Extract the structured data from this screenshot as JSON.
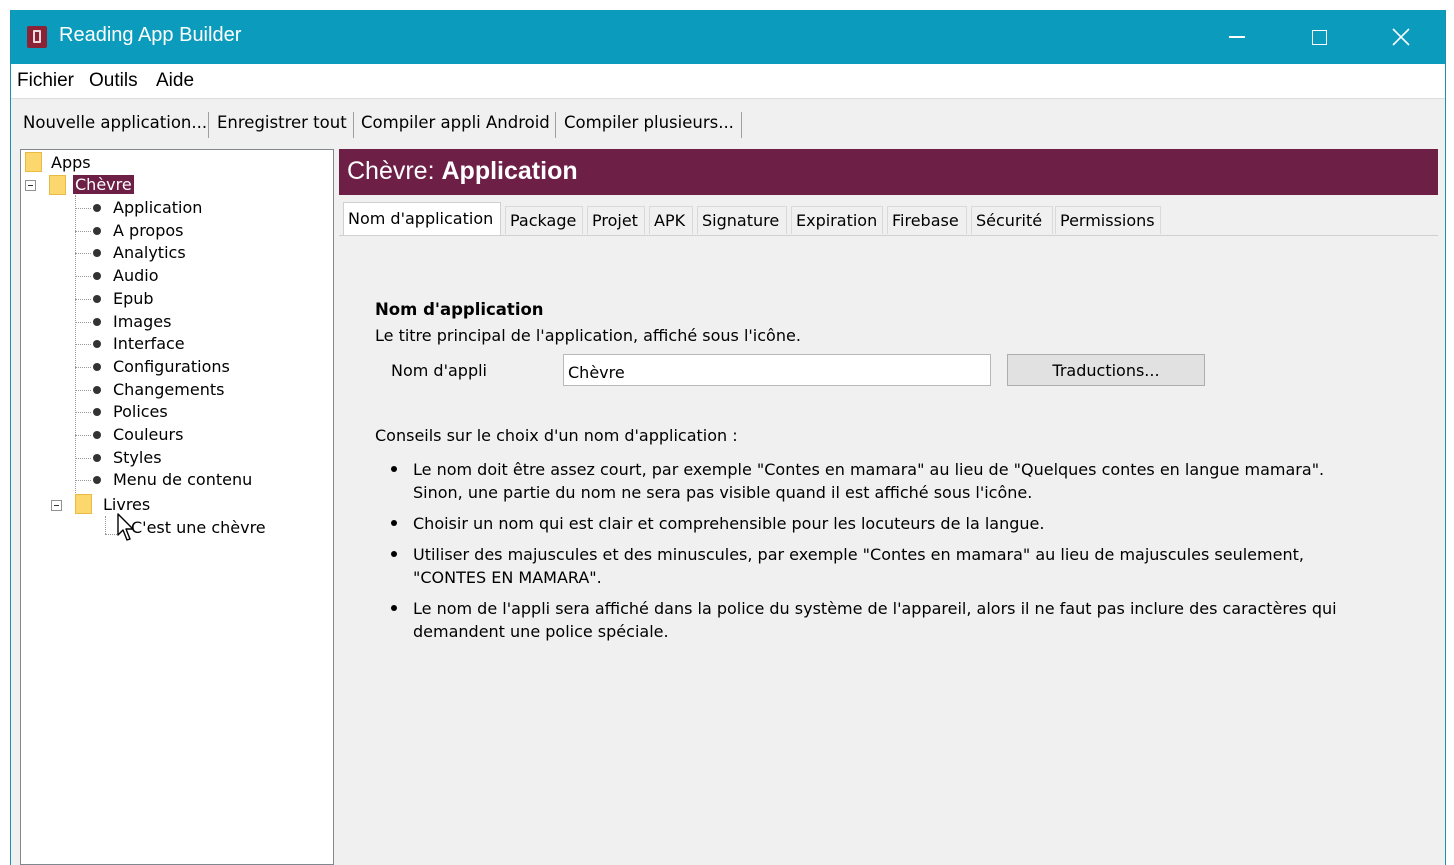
{
  "window": {
    "title": "Reading App Builder"
  },
  "menubar": [
    "Fichier",
    "Outils",
    "Aide"
  ],
  "toolbar": [
    "Nouvelle application...",
    "Enregistrer tout",
    "Compiler appli Android",
    "Compiler plusieurs..."
  ],
  "tree": {
    "root": "Apps",
    "app": "Chèvre",
    "app_items": [
      "Application",
      "A propos",
      "Analytics",
      "Audio",
      "Epub",
      "Images",
      "Interface",
      "Configurations",
      "Changements",
      "Polices",
      "Couleurs",
      "Styles",
      "Menu de contenu"
    ],
    "books_folder": "Livres",
    "books": [
      "C'est une chèvre"
    ]
  },
  "header": {
    "app_name": "Chèvre:",
    "section": "Application"
  },
  "tabs": [
    "Nom d'application",
    "Package",
    "Projet",
    "APK",
    "Signature",
    "Expiration",
    "Firebase",
    "Sécurité",
    "Permissions"
  ],
  "form": {
    "section_title": "Nom d'application",
    "section_desc": "Le titre principal de l'application, affiché sous l'icône.",
    "field_label": "Nom d'appli",
    "field_value": "Chèvre",
    "translations_button": "Traductions...",
    "tips_heading": "Conseils sur le choix d'un nom d'application :",
    "tips": [
      "Le nom doit être assez court, par exemple \"Contes en mamara\" au lieu de \"Quelques contes en langue mamara\". Sinon, une partie du nom ne sera pas visible quand il est affiché sous l'icône.",
      "Choisir un nom qui est clair et comprehensible pour les locuteurs de la langue.",
      "Utiliser des majuscules et des minuscules, par exemple \"Contes en mamara\" au lieu de majuscules seulement, \"CONTES EN MAMARA\".",
      "Le nom de l'appli sera affiché dans la police du système de l'appareil, alors il ne faut pas inclure des caractères qui demandent une police spéciale."
    ]
  }
}
